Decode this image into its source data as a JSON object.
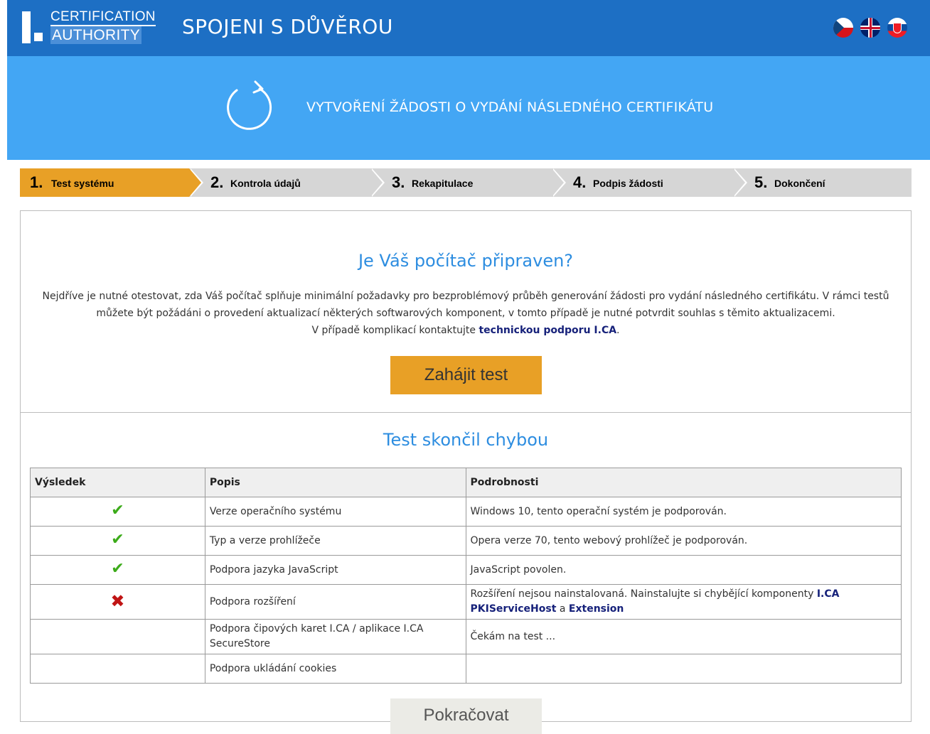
{
  "header": {
    "logo_line1": "CERTIFICATION",
    "logo_line2": "AUTHORITY",
    "slogan": "SPOJENI S DŮVĚROU",
    "languages": [
      "cz",
      "uk",
      "sk"
    ]
  },
  "banner": {
    "icon": "refresh-icon",
    "title": "VYTVOŘENÍ ŽÁDOSTI O VYDÁNÍ NÁSLEDNÉHO CERTIFIKÁTU"
  },
  "steps": [
    {
      "num": "1.",
      "label": "Test systému",
      "active": true
    },
    {
      "num": "2.",
      "label": "Kontrola údajů",
      "active": false
    },
    {
      "num": "3.",
      "label": "Rekapitulace",
      "active": false
    },
    {
      "num": "4.",
      "label": "Podpis žádosti",
      "active": false
    },
    {
      "num": "5.",
      "label": "Dokončení",
      "active": false
    }
  ],
  "check": {
    "title": "Je Váš počítač připraven?",
    "intro_text": "Nejdříve je nutné otestovat, zda Váš počítač splňuje minimální požadavky pro bezproblémový průběh generování žádosti pro vydání následného certifikátu. V rámci testů můžete být požádáni o provedení aktualizací některých softwarových komponent, v tomto případě je nutné potvrdit souhlas s těmito aktualizacemi.",
    "contact_prefix": "V případě komplikací kontaktujte",
    "contact_link": "technickou podporu I.CA",
    "contact_suffix": ".",
    "start_button": "Zahájit test"
  },
  "results": {
    "title": "Test skončil chybou",
    "headers": [
      "Výsledek",
      "Popis",
      "Podrobnosti"
    ],
    "rows": [
      {
        "status": "ok",
        "desc": "Verze operačního systému",
        "detail": "Windows 10, tento operační systém je podporován."
      },
      {
        "status": "ok",
        "desc": "Typ a verze prohlížeče",
        "detail": "Opera verze 70, tento webový prohlížeč je podporován."
      },
      {
        "status": "ok",
        "desc": "Podpora jazyka JavaScript",
        "detail": "JavaScript povolen."
      },
      {
        "status": "error",
        "desc": "Podpora rozšíření",
        "detail_prefix": "Rozšíření nejsou nainstalovaná. Nainstalujte si chybějící komponenty",
        "link1": "I.CA PKIServiceHost",
        "conj": "a",
        "link2": "Extension"
      },
      {
        "status": "",
        "desc": "Podpora čipových karet I.CA / aplikace I.CA SecureStore",
        "detail": "Čekám na test ..."
      },
      {
        "status": "",
        "desc": "Podpora ukládání cookies",
        "detail": ""
      }
    ]
  },
  "continue_button": "Pokračovat",
  "colors": {
    "header_bg": "#1d6fc4",
    "banner_bg": "#43a6f4",
    "accent_orange": "#e8a026",
    "step_inactive": "#d6d6d6",
    "title_blue": "#2d8de0",
    "link_navy": "#16217a",
    "ok_green": "#3cab1a",
    "error_red": "#c01414"
  }
}
